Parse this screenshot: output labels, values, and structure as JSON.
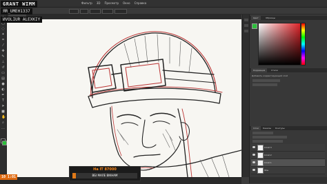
{
  "menubar": {
    "items": [
      "Фильтр",
      "3D",
      "Просмотр",
      "Окно",
      "Справка"
    ]
  },
  "overlay": {
    "name": "GRANT WIMM",
    "id": "ЯR_UMEH1337",
    "alias": "ИVOLIUR ALEXKIY",
    "counter": "10 1:01",
    "donate_title": "На IT 87000",
    "donate_label": "ВБІ МАЛЕ ВІКНАМ",
    "donate_progress": 0.05
  },
  "panels": {
    "tabs_top": [
      "Цвет",
      "Образцы"
    ],
    "tabs_mid": [
      "Коррекция",
      "Стили"
    ],
    "tabs_layers": [
      "Слои",
      "Каналы",
      "Контуры"
    ],
    "adj_label": "Добавить корректирующий слой"
  },
  "layers": [
    {
      "name": "Слой 3",
      "selected": false
    },
    {
      "name": "Слой 2",
      "selected": false
    },
    {
      "name": "Слой 1",
      "selected": true
    },
    {
      "name": "Фон",
      "selected": false
    }
  ],
  "colors": {
    "foreground": "#2bbf3a",
    "accent": "#e07a18"
  }
}
